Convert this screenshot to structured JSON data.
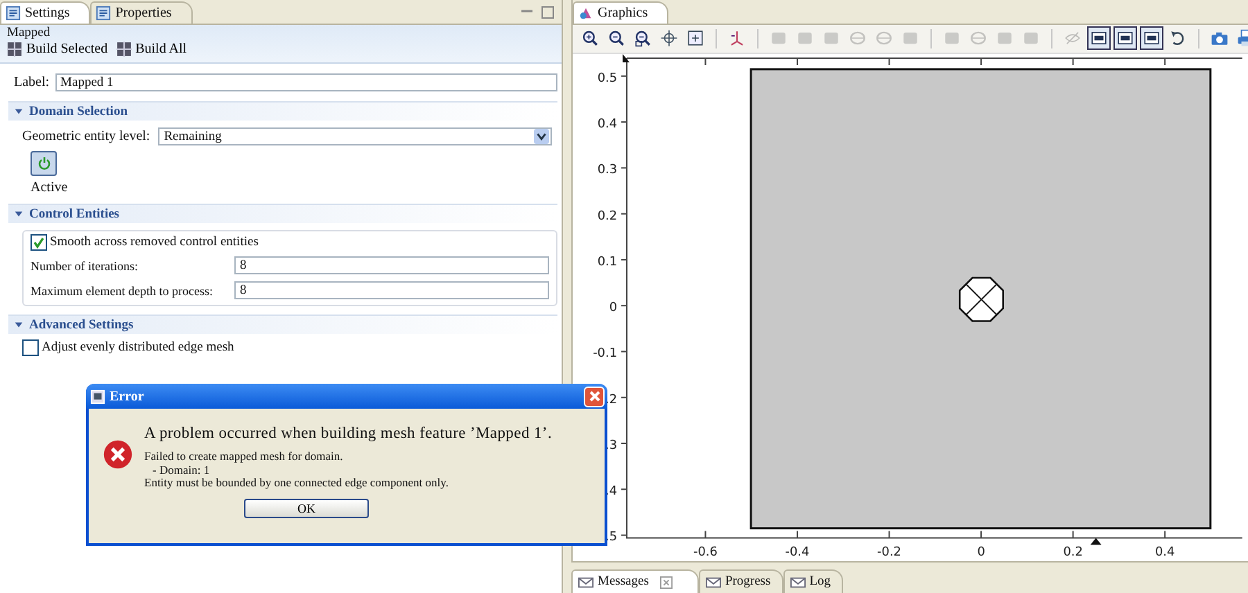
{
  "settings_panel": {
    "tabs": [
      {
        "label": "Settings",
        "selected": true
      },
      {
        "label": "Properties",
        "selected": false
      }
    ],
    "node_title": "Mapped",
    "build_buttons": [
      {
        "label": "Build Selected"
      },
      {
        "label": "Build All"
      }
    ],
    "label_field": {
      "label": "Label:",
      "value": "Mapped 1"
    },
    "sections": [
      {
        "kind": "domain",
        "title": "Domain Selection",
        "expanded": true,
        "field_label": "Geometric entity level:",
        "field_value": "Remaining",
        "active_label": "Active",
        "active_on": true
      },
      {
        "kind": "control",
        "title": "Control Entities",
        "expanded": true,
        "checkbox_label": "Smooth across removed control entities",
        "checked": true,
        "fields": [
          {
            "label": "Number of iterations:",
            "value": "8"
          },
          {
            "label": "Maximum element depth to process:",
            "value": "8"
          }
        ]
      },
      {
        "kind": "advanced",
        "title": "Advanced Settings",
        "expanded": true,
        "checkbox_label": "Adjust evenly distributed edge mesh",
        "checked": false
      }
    ]
  },
  "graphics_panel": {
    "tab": "Graphics",
    "toolbar": [
      {
        "kind": "zoom-in",
        "disabled": false,
        "on": false
      },
      {
        "kind": "zoom-out",
        "disabled": false,
        "on": false
      },
      {
        "kind": "zoom-box",
        "disabled": false,
        "on": false
      },
      {
        "kind": "crosshair",
        "disabled": false,
        "on": false
      },
      {
        "kind": "extents",
        "disabled": false,
        "on": false
      },
      {
        "kind": "separator"
      },
      {
        "kind": "axes",
        "disabled": false,
        "on": false
      },
      {
        "kind": "separator"
      },
      {
        "kind": "square",
        "disabled": true,
        "on": false
      },
      {
        "kind": "square",
        "disabled": true,
        "on": false
      },
      {
        "kind": "square",
        "disabled": true,
        "on": false
      },
      {
        "kind": "circle",
        "disabled": true,
        "on": false
      },
      {
        "kind": "circle",
        "disabled": true,
        "on": false
      },
      {
        "kind": "square",
        "disabled": true,
        "on": false
      },
      {
        "kind": "separator"
      },
      {
        "kind": "square",
        "disabled": true,
        "on": false
      },
      {
        "kind": "circle",
        "disabled": true,
        "on": false
      },
      {
        "kind": "square",
        "disabled": true,
        "on": false
      },
      {
        "kind": "square",
        "disabled": true,
        "on": false
      },
      {
        "kind": "separator"
      },
      {
        "kind": "eye",
        "disabled": true,
        "on": false
      },
      {
        "kind": "window",
        "disabled": false,
        "on": true
      },
      {
        "kind": "window",
        "disabled": false,
        "on": true
      },
      {
        "kind": "window",
        "disabled": false,
        "on": true
      },
      {
        "kind": "undo",
        "disabled": false,
        "on": false
      },
      {
        "kind": "separator"
      },
      {
        "kind": "camera",
        "disabled": false,
        "on": false
      },
      {
        "kind": "printer",
        "disabled": false,
        "on": false
      }
    ],
    "y_ticks": [
      "0.5",
      "0.4",
      "0.3",
      "0.2",
      "0.1",
      "0",
      "-0.1",
      ".2",
      ".3",
      ".4",
      ".5"
    ],
    "x_ticks": [
      "-0.6",
      "-0.4",
      "-0.2",
      "0",
      "0.2",
      "0.4"
    ]
  },
  "bottom_tabs": [
    {
      "label": "Messages",
      "selected": true
    },
    {
      "label": "Progress",
      "selected": false
    },
    {
      "label": "Log",
      "selected": false
    }
  ],
  "error_dialog": {
    "title": "Error",
    "message": "A problem occurred when building mesh feature ’Mapped 1’.",
    "details": [
      "Failed to create mapped mesh for domain.",
      "- Domain: 1",
      "Entity must be bounded by one connected edge component only."
    ],
    "button": "OK"
  }
}
